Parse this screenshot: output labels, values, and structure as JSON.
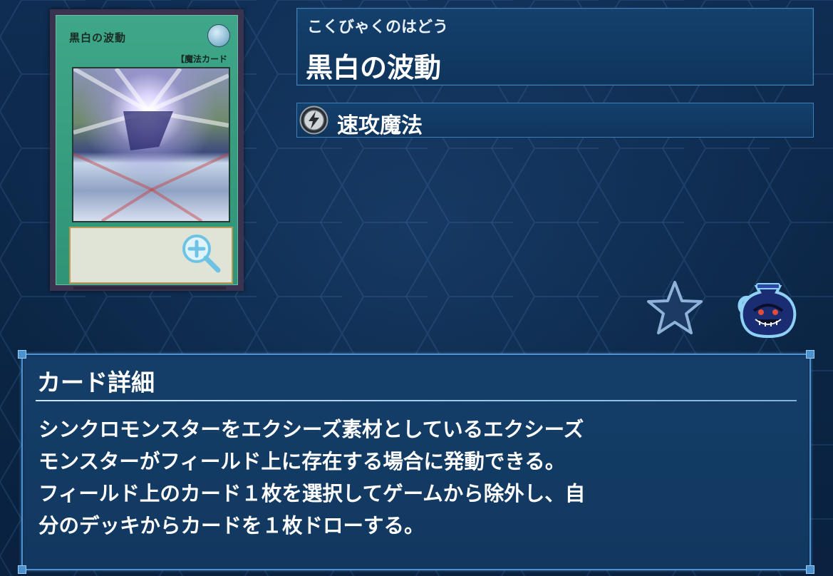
{
  "card": {
    "name_on_card": "黒白の波動",
    "attribute_text": "魔",
    "type_on_card": "【魔法カード",
    "type_symbol": "⚡"
  },
  "header": {
    "reading": "こくびゃくのはどう",
    "name": "黒白の波動"
  },
  "spell_type": {
    "label": "速攻魔法",
    "icon": "quick-play-icon"
  },
  "actions": {
    "favorite_icon": "star-icon",
    "pot_icon": "pot-of-greed-icon",
    "zoom_icon": "magnify-plus-icon"
  },
  "details": {
    "title": "カード詳細",
    "text": "シンクロモンスターをエクシーズ素材としているエクシーズ\nモンスターがフィールド上に存在する場合に発動できる。\nフィールド上のカード１枚を選択してゲームから除外し、自\n分のデッキからカードを１枚ドローする。"
  },
  "colors": {
    "background": "#0c2747",
    "panel": "#123b65",
    "panel_border": "#4c92d0",
    "card_frame": "#3fa789"
  }
}
